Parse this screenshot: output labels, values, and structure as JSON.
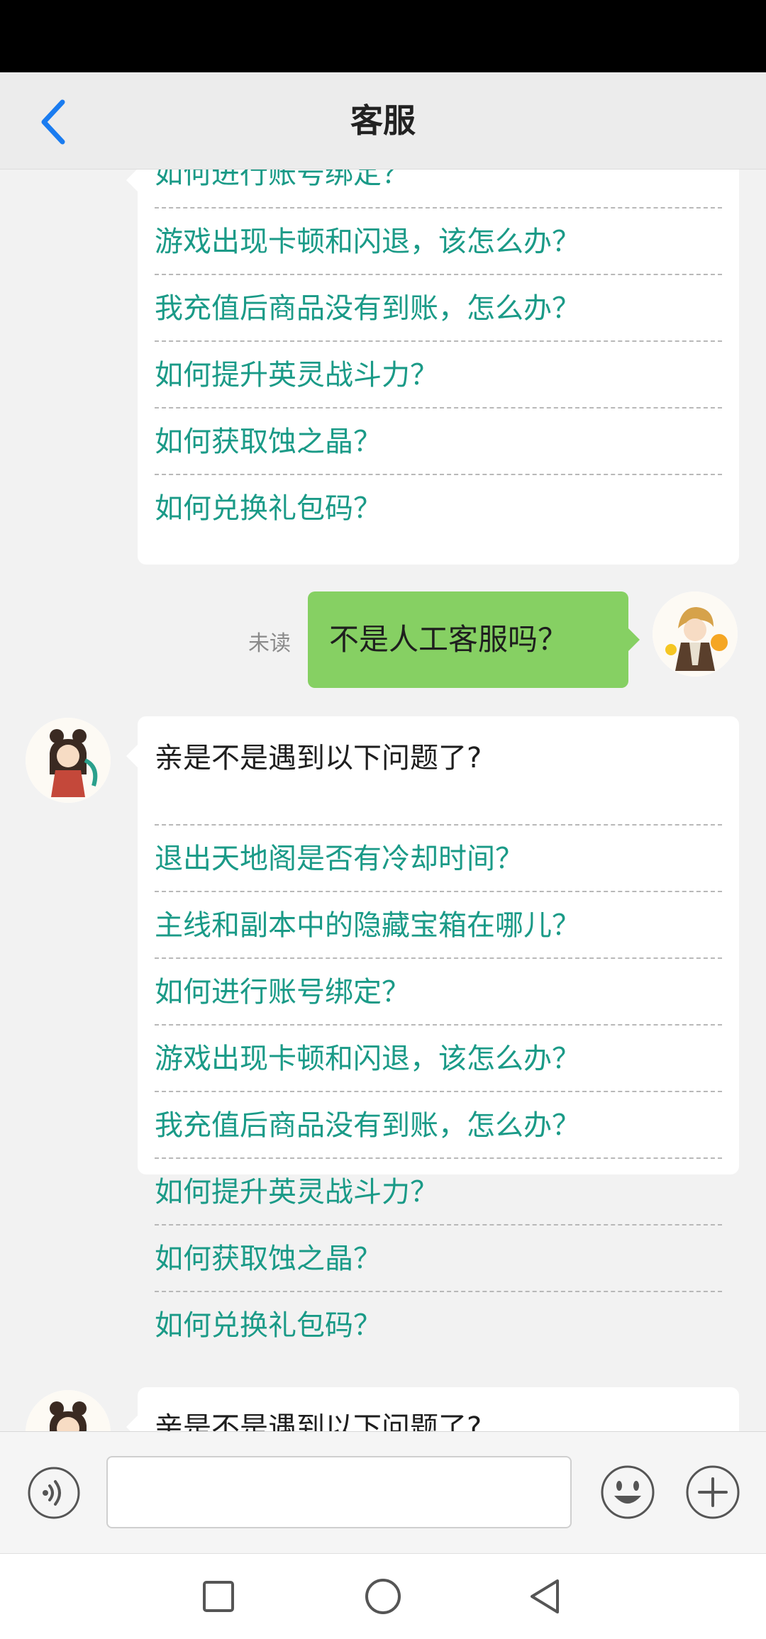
{
  "header": {
    "title": "客服"
  },
  "chat": {
    "bubble1_faqs": [
      "如何进行账号绑定？",
      "游戏出现卡顿和闪退，该怎么办？",
      "我充值后商品没有到账，怎么办？",
      "如何提升英灵战斗力？",
      "如何获取蚀之晶？",
      "如何兑换礼包码？"
    ],
    "user_message": {
      "text": "不是人工客服吗？",
      "status": "未读"
    },
    "bubble2": {
      "greeting": "亲是不是遇到以下问题了?",
      "faqs": [
        "退出天地阁是否有冷却时间？",
        "主线和副本中的隐藏宝箱在哪儿？",
        "如何进行账号绑定？",
        "游戏出现卡顿和闪退，该怎么办？",
        "我充值后商品没有到账，怎么办？",
        "如何提升英灵战斗力？",
        "如何获取蚀之晶？",
        "如何兑换礼包码？"
      ]
    },
    "bubble3": {
      "greeting": "亲是不是遇到以下问题了?"
    }
  },
  "input_bar": {
    "placeholder": ""
  },
  "icons": {
    "back": "chevron-left-icon",
    "voice": "voice-icon",
    "emoji": "smiley-icon",
    "plus": "plus-icon",
    "nav_recents": "square-icon",
    "nav_home": "circle-icon",
    "nav_back": "triangle-back-icon"
  },
  "colors": {
    "accent_blue": "#1a7cf0",
    "faq_teal": "#1a9a87",
    "user_bubble_green": "#86d063"
  }
}
